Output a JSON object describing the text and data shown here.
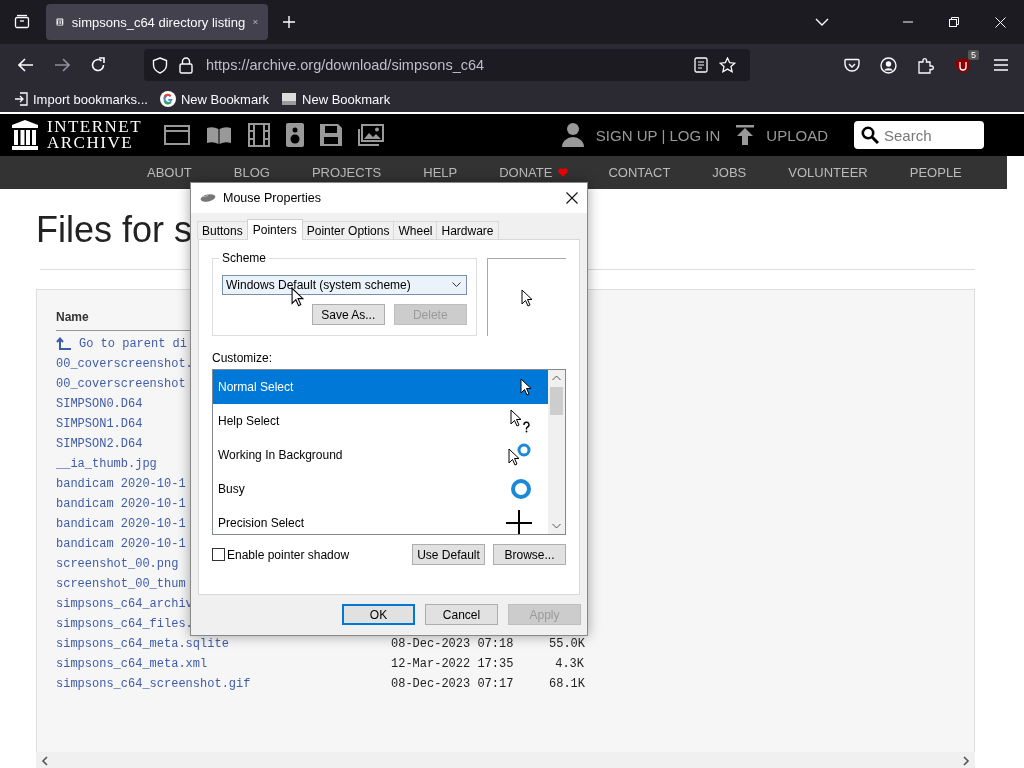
{
  "browser": {
    "tab": {
      "title": "simpsons_c64 directory listing",
      "selected": true
    },
    "url": {
      "host": "https://archive.org",
      "path": "/download/simpsons_c64"
    },
    "extensions_badge": "5",
    "bookmarks": [
      {
        "label": "Import bookmarks...",
        "kind": "import"
      },
      {
        "label": "New Bookmark",
        "kind": "google"
      },
      {
        "label": "New Bookmark",
        "kind": "page"
      }
    ]
  },
  "site_header": {
    "logo_lines": [
      "INTERNET",
      "ARCHIVE"
    ],
    "account": "SIGN UP | LOG IN",
    "upload": "UPLOAD",
    "search": {
      "placeholder": "Search"
    },
    "nav": [
      {
        "label": "ABOUT",
        "heart": false
      },
      {
        "label": "BLOG",
        "heart": false
      },
      {
        "label": "PROJECTS",
        "heart": false
      },
      {
        "label": "HELP",
        "heart": false
      },
      {
        "label": "DONATE",
        "heart": true
      },
      {
        "label": "CONTACT",
        "heart": false
      },
      {
        "label": "JOBS",
        "heart": false
      },
      {
        "label": "VOLUNTEER",
        "heart": false
      },
      {
        "label": "PEOPLE",
        "heart": false
      }
    ]
  },
  "page": {
    "heading": "Files for s",
    "columns": [
      "Name"
    ],
    "files": [
      {
        "name": "Go to parent di",
        "kind": "parent"
      },
      {
        "name": "00_coverscreenshot.",
        "kind": "file"
      },
      {
        "name": "00_coverscreenshot",
        "kind": "file"
      },
      {
        "name": "SIMPSON0.D64",
        "kind": "file"
      },
      {
        "name": "SIMPSON1.D64",
        "kind": "file"
      },
      {
        "name": "SIMPSON2.D64",
        "kind": "file"
      },
      {
        "name": "__ia_thumb.jpg",
        "kind": "file"
      },
      {
        "name": "bandicam 2020-10-1",
        "kind": "file"
      },
      {
        "name": "bandicam 2020-10-1",
        "kind": "file"
      },
      {
        "name": "bandicam 2020-10-1",
        "kind": "file"
      },
      {
        "name": "bandicam 2020-10-1",
        "kind": "file"
      },
      {
        "name": "screenshot_00.png",
        "kind": "file"
      },
      {
        "name": "screenshot_00_thum",
        "kind": "file"
      },
      {
        "name": "simpsons_c64_archiv",
        "kind": "file"
      },
      {
        "name": "simpsons_c64_files.",
        "kind": "file"
      },
      {
        "name": "simpsons_c64_meta.sqlite",
        "kind": "file",
        "date": "08-Dec-2023 07:18",
        "size": "55.0K"
      },
      {
        "name": "simpsons_c64_meta.xml",
        "kind": "file",
        "date": "12-Mar-2022 17:35",
        "size": "4.3K"
      },
      {
        "name": "simpsons_c64_screenshot.gif",
        "kind": "file",
        "date": "08-Dec-2023 07:17",
        "size": "68.1K"
      }
    ]
  },
  "dialog": {
    "title": "Mouse Properties",
    "tabs": [
      {
        "label": "Buttons",
        "selected": false
      },
      {
        "label": "Pointers",
        "selected": true
      },
      {
        "label": "Pointer Options",
        "selected": false
      },
      {
        "label": "Wheel",
        "selected": false
      },
      {
        "label": "Hardware",
        "selected": false
      }
    ],
    "scheme": {
      "label": "Scheme",
      "value": "Windows Default (system scheme)",
      "buttons": [
        {
          "label": "Save As...",
          "disabled": false
        },
        {
          "label": "Delete",
          "disabled": true
        }
      ]
    },
    "customize": {
      "label": "Customize:",
      "items": [
        {
          "label": "Normal Select",
          "kind": "arrow",
          "selected": true
        },
        {
          "label": "Help Select",
          "kind": "help",
          "selected": false
        },
        {
          "label": "Working In Background",
          "kind": "working",
          "selected": false
        },
        {
          "label": "Busy",
          "kind": "busy",
          "selected": false
        },
        {
          "label": "Precision Select",
          "kind": "cross",
          "selected": false
        }
      ]
    },
    "pointer_shadow": {
      "label": "Enable pointer shadow",
      "checked": false
    },
    "side_buttons": [
      {
        "label": "Use Default",
        "disabled": false
      },
      {
        "label": "Browse...",
        "disabled": false
      }
    ],
    "buttons": [
      {
        "label": "OK",
        "default": true,
        "disabled": false
      },
      {
        "label": "Cancel",
        "default": false,
        "disabled": false
      },
      {
        "label": "Apply",
        "default": false,
        "disabled": true
      }
    ]
  }
}
